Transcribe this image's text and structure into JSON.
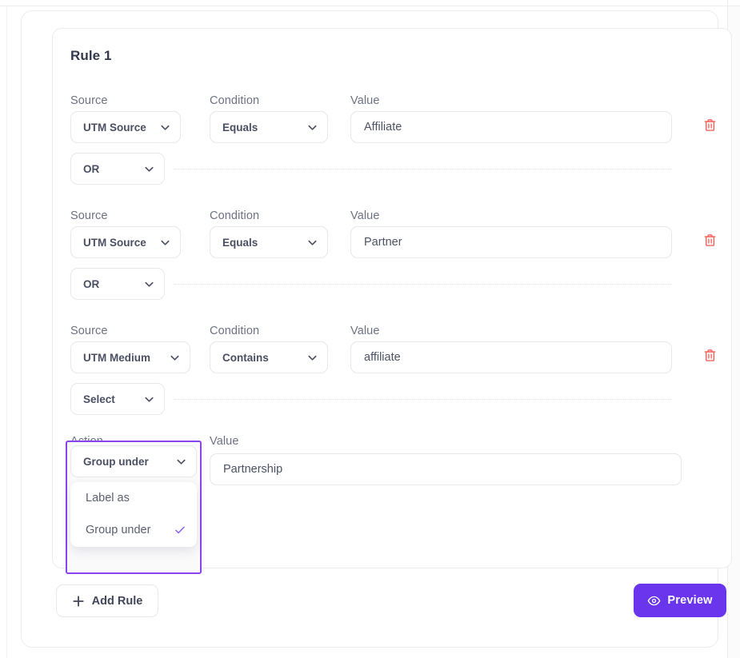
{
  "card": {
    "title": "Rule 1"
  },
  "labels": {
    "source": "Source",
    "condition": "Condition",
    "value": "Value",
    "action": "Action"
  },
  "conditions": [
    {
      "source_label": "Source",
      "source_value": "UTM Source",
      "condition_label": "Condition",
      "condition_value": "Equals",
      "value_label": "Value",
      "value": "Affiliate",
      "delete_icon": "trash-icon",
      "logic_operator": "OR"
    },
    {
      "source_label": "Source",
      "source_value": "UTM Source",
      "condition_label": "Condition",
      "condition_value": "Equals",
      "value_label": "Value",
      "value": "Partner",
      "delete_icon": "trash-icon",
      "logic_operator": "OR"
    },
    {
      "source_label": "Source",
      "source_value": "UTM Medium",
      "condition_label": "Condition",
      "condition_value": "Contains",
      "value_label": "Value",
      "value": "affiliate",
      "delete_icon": "trash-icon",
      "logic_operator": "Select"
    }
  ],
  "action": {
    "action_label": "Action",
    "action_value": "Group under",
    "value_label": "Value",
    "value": "Partnership",
    "dropdown_open": true,
    "dropdown_options": [
      {
        "label": "Label as",
        "selected": false
      },
      {
        "label": "Group under",
        "selected": true
      }
    ]
  },
  "footer": {
    "add_rule_label": "Add Rule",
    "add_rule_icon": "plus-icon",
    "preview_label": "Preview",
    "preview_icon": "eye-icon"
  },
  "colors": {
    "accent_purple": "#6a35ec",
    "focus_purple": "#8b43f0",
    "delete_red": "#f5635b",
    "text_dark": "#33384d",
    "text_muted": "#6d7283",
    "border": "#e7e7ec"
  }
}
